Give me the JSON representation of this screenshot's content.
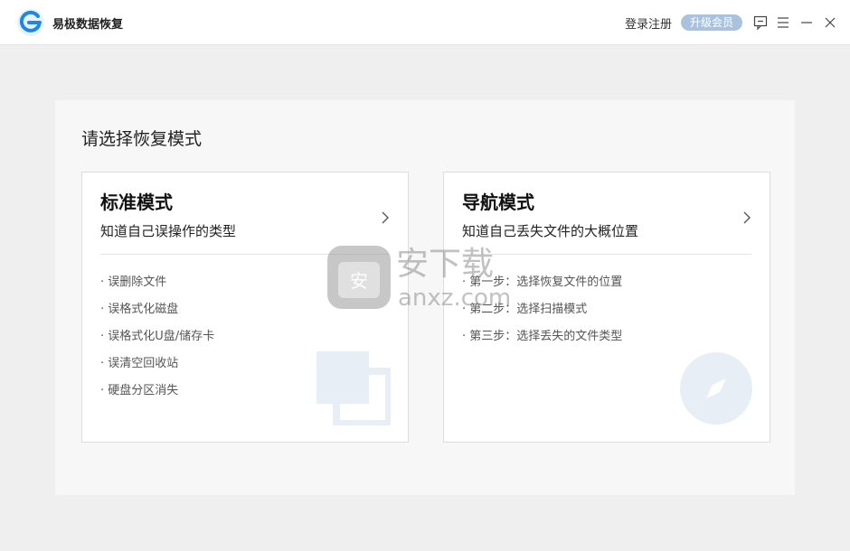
{
  "app": {
    "title": "易极数据恢复"
  },
  "header": {
    "login_label": "登录注册",
    "upgrade_label": "升级会员"
  },
  "panel": {
    "title": "请选择恢复模式"
  },
  "cards": [
    {
      "title": "标准模式",
      "subtitle": "知道自己误操作的类型",
      "items": [
        "· 误删除文件",
        "· 误格式化磁盘",
        "· 误格式化U盘/储存卡",
        "· 误清空回收站",
        "· 硬盘分区消失"
      ],
      "deco_icon": "copy-squares-icon"
    },
    {
      "title": "导航模式",
      "subtitle": "知道自己丢失文件的大概位置",
      "items": [
        "· 第一步：选择恢复文件的位置",
        "· 第二步：选择扫描模式",
        "· 第三步：选择丢失的文件类型"
      ],
      "deco_icon": "compass-icon"
    }
  ],
  "watermark": {
    "text_cn": "安下载",
    "text_en": "anxz.com"
  },
  "colors": {
    "accent": "#1e88e5",
    "upgrade_bg": "#a9c3df",
    "deco": "#e8eef5"
  }
}
